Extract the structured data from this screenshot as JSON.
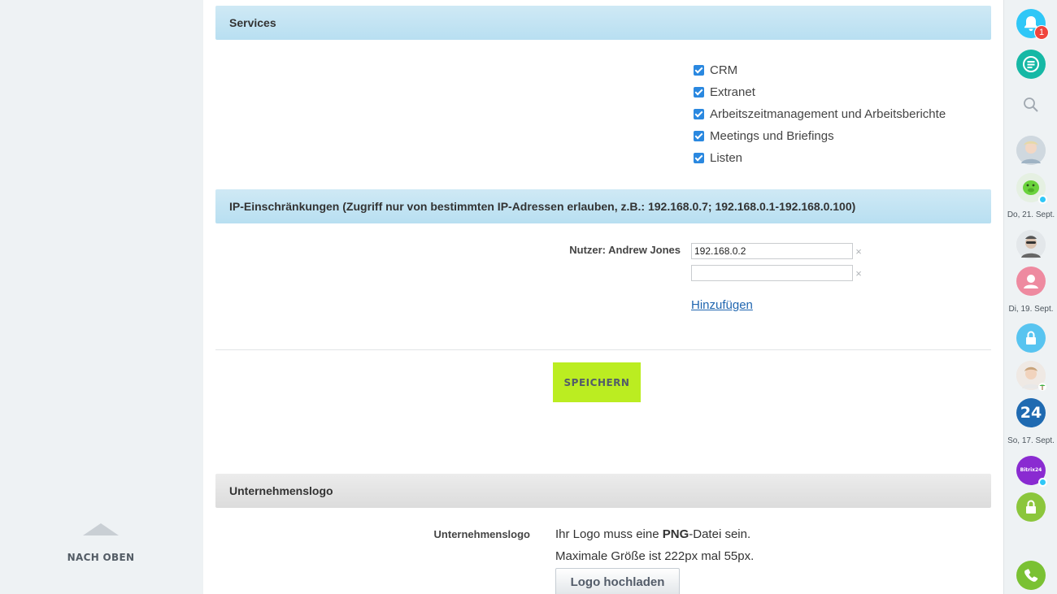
{
  "services": {
    "title": "Services",
    "items": [
      {
        "label": "CRM",
        "checked": true
      },
      {
        "label": "Extranet",
        "checked": true
      },
      {
        "label": "Arbeitszeitmanagement und Arbeitsberichte",
        "checked": true
      },
      {
        "label": "Meetings und Briefings",
        "checked": true
      },
      {
        "label": "Listen",
        "checked": true
      }
    ]
  },
  "ip_restrictions": {
    "title": "IP-Einschränkungen (Zugriff nur von bestimmten IP-Adressen erlauben, z.B.: 192.168.0.7; 192.168.0.1-192.168.0.100)",
    "user_label": "Nutzer: Andrew Jones",
    "inputs": [
      {
        "value": "192.168.0.2",
        "clear_icon": "×"
      },
      {
        "value": "",
        "clear_icon": "×"
      }
    ],
    "add_link": "Hinzufügen"
  },
  "save_button": "SPEICHERN",
  "company_logo": {
    "title": "Unternehmenslogo",
    "field_label": "Unternehmenslogo",
    "hint_pre": "Ihr Logo muss eine ",
    "hint_bold": "PNG",
    "hint_post": "-Datei sein.",
    "size_hint": "Maximale Größe ist 222px mal 55px.",
    "upload_button": "Logo hochladen"
  },
  "to_top": {
    "label": "NACH OBEN"
  },
  "sidebar": {
    "notification_count": "1",
    "dates": [
      "Do, 21. Sept.",
      "Di, 19. Sept.",
      "So, 17. Sept."
    ],
    "bitrix_number": "24",
    "bitrix_small_logo": "Bitrix24",
    "colors": {
      "notifications": "#2fc7f7",
      "chat": "#16b8a5",
      "lock_blue": "#58c4f0",
      "lock_green": "#8bc63c",
      "phone": "#7ac133",
      "bitrix": "#1f6ab1",
      "bitrix_purple": "#8a2bd1",
      "pink": "#ee8aa0"
    }
  }
}
